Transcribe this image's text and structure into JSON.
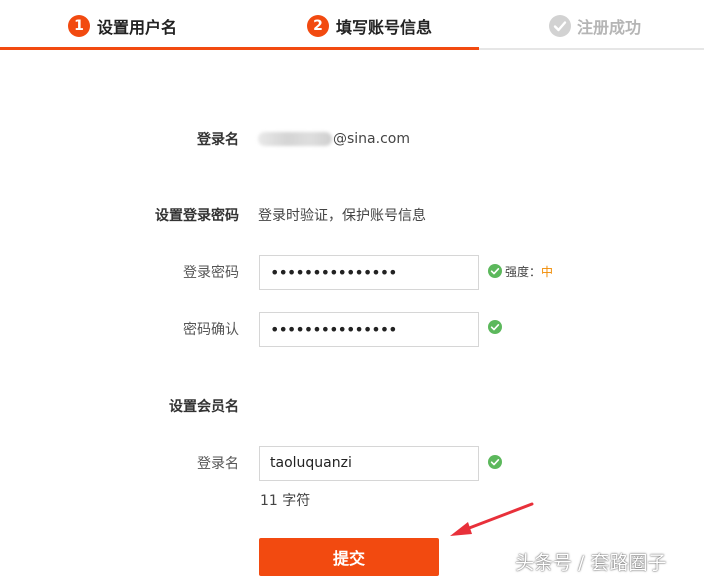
{
  "steps": [
    {
      "number": "1",
      "label": "设置用户名"
    },
    {
      "number": "2",
      "label": "填写账号信息"
    },
    {
      "number": "",
      "label": "注册成功"
    }
  ],
  "login": {
    "label": "登录名",
    "email_suffix": "@sina.com"
  },
  "password_section": {
    "title": "设置登录密码",
    "hint": "登录时验证，保护账号信息",
    "password_label": "登录密码",
    "password_value": "•••••••••••••••",
    "strength_label": "强度：",
    "strength_level": "中",
    "confirm_label": "密码确认",
    "confirm_value": "•••••••••••••••"
  },
  "member_section": {
    "title": "设置会员名",
    "username_label": "登录名",
    "username_value": "taoluquanzi",
    "char_count": "11 字符"
  },
  "submit_label": "提交",
  "watermark": "头条号 / 套路圈子",
  "colors": {
    "accent": "#f24a10",
    "success": "#5cb85c",
    "strength_medium": "#f08a00"
  }
}
